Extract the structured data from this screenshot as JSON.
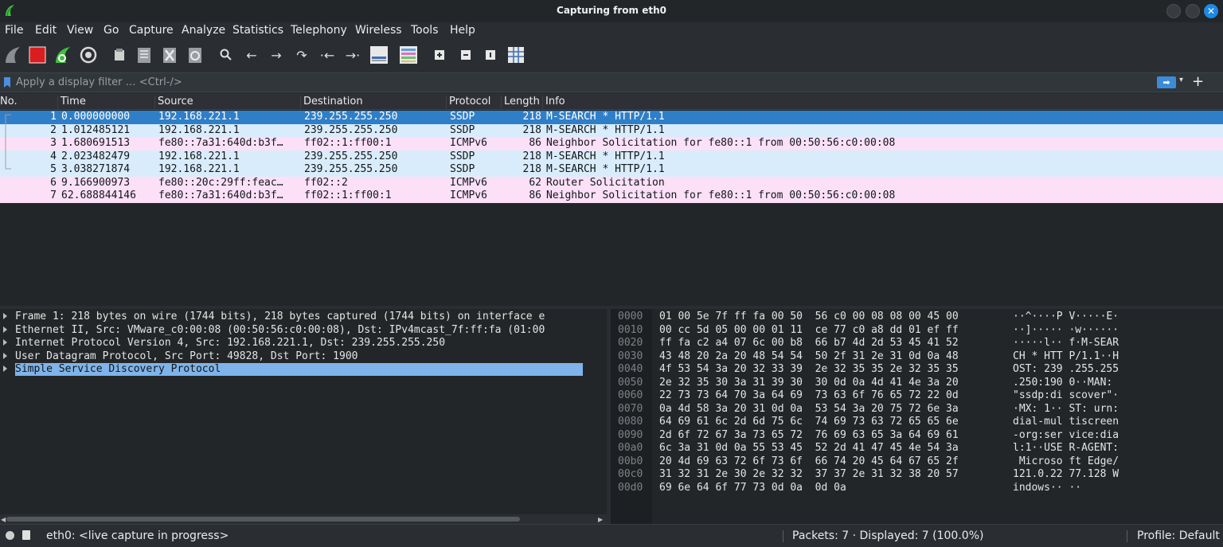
{
  "window": {
    "title": "Capturing from eth0"
  },
  "menu": [
    {
      "label": "File"
    },
    {
      "label": "Edit"
    },
    {
      "label": "View"
    },
    {
      "label": "Go"
    },
    {
      "label": "Capture"
    },
    {
      "label": "Analyze"
    },
    {
      "label": "Statistics"
    },
    {
      "label": "Telephony"
    },
    {
      "label": "Wireless"
    },
    {
      "label": "Tools"
    },
    {
      "label": "Help"
    }
  ],
  "toolbar": {
    "icons": [
      "start-capture-icon",
      "stop-capture-icon",
      "restart-capture-icon",
      "capture-options-icon",
      "open-file-icon",
      "save-file-icon",
      "close-file-icon",
      "reload-file-icon",
      "find-packet-icon",
      "go-back-icon",
      "go-forward-icon",
      "go-to-packet-icon",
      "first-packet-icon",
      "last-packet-icon",
      "autoscroll-icon",
      "colorize-icon",
      "zoom-in-icon",
      "zoom-out-icon",
      "normal-size-icon",
      "resize-columns-icon"
    ]
  },
  "filter": {
    "placeholder": "Apply a display filter … <Ctrl-/>"
  },
  "packet_list": {
    "columns": [
      "No.",
      "Time",
      "Source",
      "Destination",
      "Protocol",
      "Length",
      "Info"
    ],
    "rows": [
      {
        "no": "1",
        "time": "0.000000000",
        "source": "192.168.221.1",
        "destination": "239.255.255.250",
        "protocol": "SSDP",
        "length": "218",
        "info": "M-SEARCH * HTTP/1.1",
        "color": "#2f7fc8",
        "selected": true
      },
      {
        "no": "2",
        "time": "1.012485121",
        "source": "192.168.221.1",
        "destination": "239.255.255.250",
        "protocol": "SSDP",
        "length": "218",
        "info": "M-SEARCH * HTTP/1.1",
        "color": "#d9ecfb",
        "selected": false
      },
      {
        "no": "3",
        "time": "1.680691513",
        "source": "fe80::7a31:640d:b3f…",
        "destination": "ff02::1:ff00:1",
        "protocol": "ICMPv6",
        "length": "86",
        "info": "Neighbor Solicitation for fe80::1 from 00:50:56:c0:00:08",
        "color": "#fbe0f8",
        "selected": false
      },
      {
        "no": "4",
        "time": "2.023482479",
        "source": "192.168.221.1",
        "destination": "239.255.255.250",
        "protocol": "SSDP",
        "length": "218",
        "info": "M-SEARCH * HTTP/1.1",
        "color": "#d9ecfb",
        "selected": false
      },
      {
        "no": "5",
        "time": "3.038271874",
        "source": "192.168.221.1",
        "destination": "239.255.255.250",
        "protocol": "SSDP",
        "length": "218",
        "info": "M-SEARCH * HTTP/1.1",
        "color": "#d9ecfb",
        "selected": false
      },
      {
        "no": "6",
        "time": "9.166900973",
        "source": "fe80::20c:29ff:feac…",
        "destination": "ff02::2",
        "protocol": "ICMPv6",
        "length": "62",
        "info": "Router Solicitation",
        "color": "#fbe0f8",
        "selected": false
      },
      {
        "no": "7",
        "time": "62.688844146",
        "source": "fe80::7a31:640d:b3f…",
        "destination": "ff02::1:ff00:1",
        "protocol": "ICMPv6",
        "length": "86",
        "info": "Neighbor Solicitation for fe80::1 from 00:50:56:c0:00:08",
        "color": "#fbe0f8",
        "selected": false
      }
    ]
  },
  "details": [
    {
      "text": "Frame 1: 218 bytes on wire (1744 bits), 218 bytes captured (1744 bits) on interface e",
      "selected": false
    },
    {
      "text": "Ethernet II, Src: VMware_c0:00:08 (00:50:56:c0:00:08), Dst: IPv4mcast_7f:ff:fa (01:00",
      "selected": false
    },
    {
      "text": "Internet Protocol Version 4, Src: 192.168.221.1, Dst: 239.255.255.250",
      "selected": false
    },
    {
      "text": "User Datagram Protocol, Src Port: 49828, Dst Port: 1900",
      "selected": false
    },
    {
      "text": "Simple Service Discovery Protocol",
      "selected": true
    }
  ],
  "bytes": [
    {
      "off": "0000",
      "hex": "01 00 5e 7f ff fa 00 50  56 c0 00 08 08 00 45 00",
      "ascii": "··^····P V·····E·"
    },
    {
      "off": "0010",
      "hex": "00 cc 5d 05 00 00 01 11  ce 77 c0 a8 dd 01 ef ff",
      "ascii": "··]····· ·w······"
    },
    {
      "off": "0020",
      "hex": "ff fa c2 a4 07 6c 00 b8  66 b7 4d 2d 53 45 41 52",
      "ascii": "·····l·· f·M-SEAR"
    },
    {
      "off": "0030",
      "hex": "43 48 20 2a 20 48 54 54  50 2f 31 2e 31 0d 0a 48",
      "ascii": "CH * HTT P/1.1··H"
    },
    {
      "off": "0040",
      "hex": "4f 53 54 3a 20 32 33 39  2e 32 35 35 2e 32 35 35",
      "ascii": "OST: 239 .255.255"
    },
    {
      "off": "0050",
      "hex": "2e 32 35 30 3a 31 39 30  30 0d 0a 4d 41 4e 3a 20",
      "ascii": ".250:190 0··MAN: "
    },
    {
      "off": "0060",
      "hex": "22 73 73 64 70 3a 64 69  73 63 6f 76 65 72 22 0d",
      "ascii": "\"ssdp:di scover\"·"
    },
    {
      "off": "0070",
      "hex": "0a 4d 58 3a 20 31 0d 0a  53 54 3a 20 75 72 6e 3a",
      "ascii": "·MX: 1·· ST: urn:"
    },
    {
      "off": "0080",
      "hex": "64 69 61 6c 2d 6d 75 6c  74 69 73 63 72 65 65 6e",
      "ascii": "dial-mul tiscreen"
    },
    {
      "off": "0090",
      "hex": "2d 6f 72 67 3a 73 65 72  76 69 63 65 3a 64 69 61",
      "ascii": "-org:ser vice:dia"
    },
    {
      "off": "00a0",
      "hex": "6c 3a 31 0d 0a 55 53 45  52 2d 41 47 45 4e 54 3a",
      "ascii": "l:1··USE R-AGENT:"
    },
    {
      "off": "00b0",
      "hex": "20 4d 69 63 72 6f 73 6f  66 74 20 45 64 67 65 2f",
      "ascii": " Microso ft Edge/"
    },
    {
      "off": "00c0",
      "hex": "31 32 31 2e 30 2e 32 32  37 37 2e 31 32 38 20 57",
      "ascii": "121.0.22 77.128 W"
    },
    {
      "off": "00d0",
      "hex": "69 6e 64 6f 77 73 0d 0a  0d 0a",
      "ascii": "indows·· ··"
    }
  ],
  "status": {
    "interface": "eth0: <live capture in progress>",
    "packets": "Packets: 7 · Displayed: 7 (100.0%)",
    "profile": "Profile: Default"
  }
}
